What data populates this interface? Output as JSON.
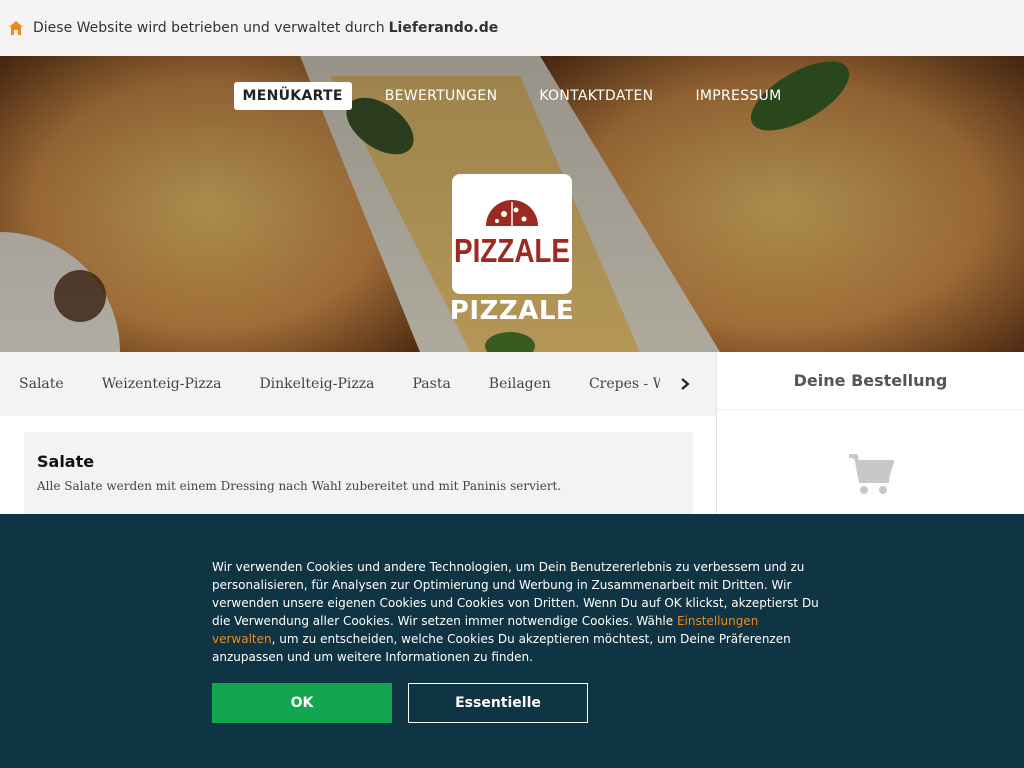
{
  "topbar": {
    "text": "Diese Website wird betrieben und verwaltet durch",
    "brand": "Lieferando.de",
    "icon": "home-icon",
    "icon_color": "#f08a1c"
  },
  "nav": {
    "items": [
      "MENÜKARTE",
      "BEWERTUNGEN",
      "KONTAKTDATEN",
      "IMPRESSUM"
    ]
  },
  "restaurant": {
    "logo_text": "PIZZALE",
    "name": "PIZZALE",
    "logo_color": "#9b2b21"
  },
  "categories": {
    "items": [
      "Salate",
      "Weizenteig-Pizza",
      "Dinkelteig-Pizza",
      "Pasta",
      "Beilagen",
      "Crepes - Waff"
    ],
    "arrow_icon": "chevron-right-icon"
  },
  "section": {
    "title": "Salate",
    "description": "Alle Salate werden mit einem Dressing nach Wahl zubereitet und mit Paninis serviert."
  },
  "order": {
    "title": "Deine Bestellung",
    "icon": "cart-icon"
  },
  "cookie": {
    "text_before": "Wir verwenden Cookies und andere Technologien, um Dein Benutzererlebnis zu verbessern und zu personalisieren, für Analysen zur Optimierung und Werbung in Zusammenarbeit mit Dritten. Wir verwenden unsere eigenen Cookies und Cookies von Dritten. Wenn Du auf OK klickst, akzeptierst Du die Verwendung aller Cookies. Wir setzen immer notwendige Cookies. Wähle ",
    "link": "Einstellungen verwalten",
    "text_after": ", um zu entscheiden, welche Cookies Du akzeptieren möchtest, um Deine Präferenzen anzupassen und um weitere Informationen zu finden.",
    "ok_label": "OK",
    "essential_label": "Essentielle",
    "bg_color": "#0f3444",
    "ok_color": "#13a54f",
    "link_color": "#f08a1c"
  }
}
